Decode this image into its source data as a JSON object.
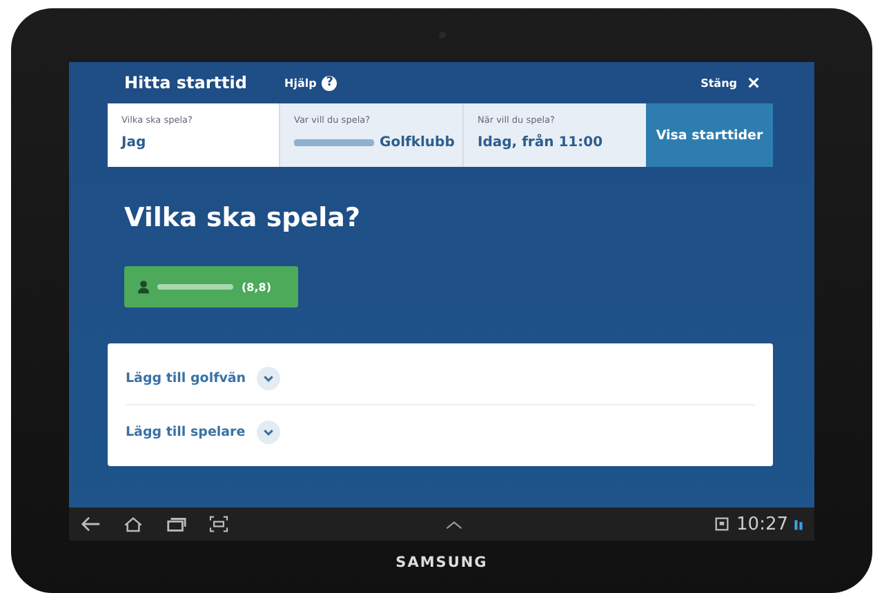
{
  "header": {
    "title": "Hitta starttid",
    "help": "Hjälp",
    "help_icon": "?",
    "close": "Stäng"
  },
  "search_fields": [
    {
      "label": "Vilka ska spela?",
      "value": "Jag",
      "value_redacted": false,
      "selected": true
    },
    {
      "label": "Var vill du spela?",
      "value": "Golfklubb",
      "value_redacted": true,
      "selected": false
    },
    {
      "label": "När vill du spela?",
      "value": "Idag, från 11:00",
      "value_redacted": false,
      "selected": false
    }
  ],
  "search_button": "Visa starttider",
  "heading": "Vilka ska spela?",
  "players": [
    {
      "name_redacted": true,
      "handicap": "(8,8)"
    }
  ],
  "actions": [
    {
      "label": "Lägg till golfvän",
      "expanded": false
    },
    {
      "label": "Lägg till spelare",
      "expanded": false
    }
  ],
  "status_bar": {
    "time": "10:27"
  },
  "device": {
    "brand": "SAMSUNG"
  }
}
